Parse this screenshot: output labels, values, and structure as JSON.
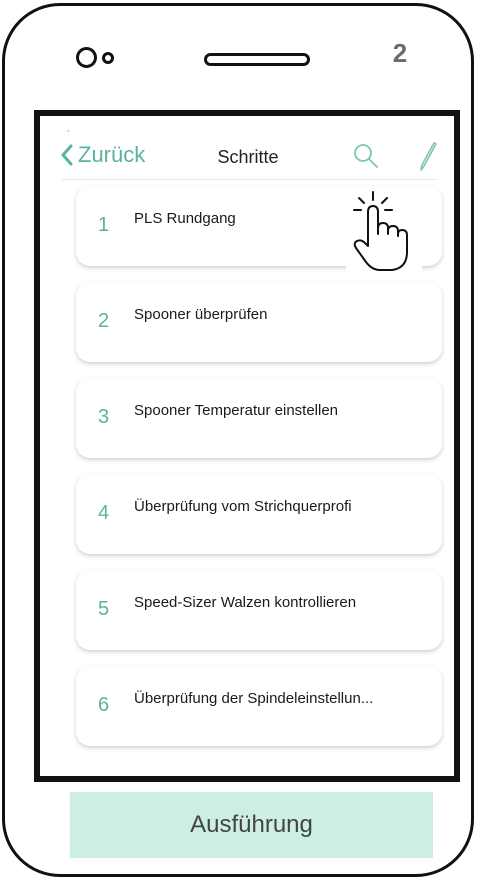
{
  "device": {
    "step_badge": "2"
  },
  "header": {
    "back_label": "Zurück",
    "title": "Schritte"
  },
  "steps": [
    {
      "number": "1",
      "label": "PLS Rundgang"
    },
    {
      "number": "2",
      "label": "Spooner überprüfen"
    },
    {
      "number": "3",
      "label": "Spooner Temperatur einstellen"
    },
    {
      "number": "4",
      "label": "Überprüfung vom Strichquerprofi"
    },
    {
      "number": "5",
      "label": "Speed-Sizer Walzen kontrollieren"
    },
    {
      "number": "6",
      "label": "Überprüfung der Spindeleinstellun..."
    }
  ],
  "footer": {
    "button_label": "Ausführung"
  },
  "colors": {
    "accent": "#5bb2a0",
    "button_bg": "#cdeee3"
  }
}
